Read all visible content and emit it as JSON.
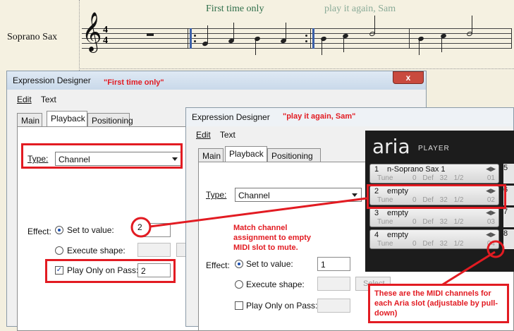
{
  "score": {
    "instrument": "Soprano Sax",
    "time_sig_top": "4",
    "time_sig_bottom": "4",
    "first_label": "First time only",
    "second_label": "play it again, Sam"
  },
  "window1": {
    "title": "Expression Designer",
    "annotation": "\"First time only\"",
    "menu": [
      "Edit",
      "Text"
    ],
    "tabs": [
      "Main",
      "Playback",
      "Positioning"
    ],
    "type_label": "Type:",
    "type_value": "Channel",
    "effect_label": "Effect:",
    "set_value_label": "Set to value:",
    "set_value": "2",
    "execute_shape_label": "Execute shape:",
    "play_only_label": "Play Only on Pass:",
    "play_only_value": "2",
    "play_only_checked": "✓"
  },
  "window2": {
    "title": "Expression Designer",
    "annotation": "\"play it again, Sam\"",
    "menu": [
      "Edit",
      "Text"
    ],
    "tabs": [
      "Main",
      "Playback",
      "Positioning"
    ],
    "type_label": "Type:",
    "type_value": "Channel",
    "effect_label": "Effect:",
    "set_value_label": "Set to value:",
    "set_value": "1",
    "execute_shape_label": "Execute shape:",
    "select_btn": "Select...",
    "play_only_label": "Play Only on Pass:"
  },
  "aria": {
    "logo": "aria",
    "logo_sub": "PLAYER",
    "slots": [
      {
        "num": "1",
        "name": "n-Soprano Sax 1",
        "tune": "Tune",
        "vals": "0 Def 32 1/2",
        "ch": "01",
        "side": "5"
      },
      {
        "num": "2",
        "name": "empty",
        "tune": "Tune",
        "vals": "0 Def 32 1/2",
        "ch": "02",
        "side": "6"
      },
      {
        "num": "3",
        "name": "empty",
        "tune": "Tune",
        "vals": "0 Def 32 1/2",
        "ch": "03",
        "side": "7"
      },
      {
        "num": "4",
        "name": "empty",
        "tune": "Tune",
        "vals": "0 Def 32 1/2",
        "ch": "04",
        "side": "8"
      }
    ]
  },
  "callouts": {
    "circle_value": "2",
    "match_text": "Match channel assignment to empty MIDI slot to mute.",
    "midi_text": "These are the MIDI channels for each Aria slot (adjustable by pull-down)"
  },
  "colors": {
    "annotation_red": "#e21b22",
    "aria_bg": "#1c1c1c"
  }
}
